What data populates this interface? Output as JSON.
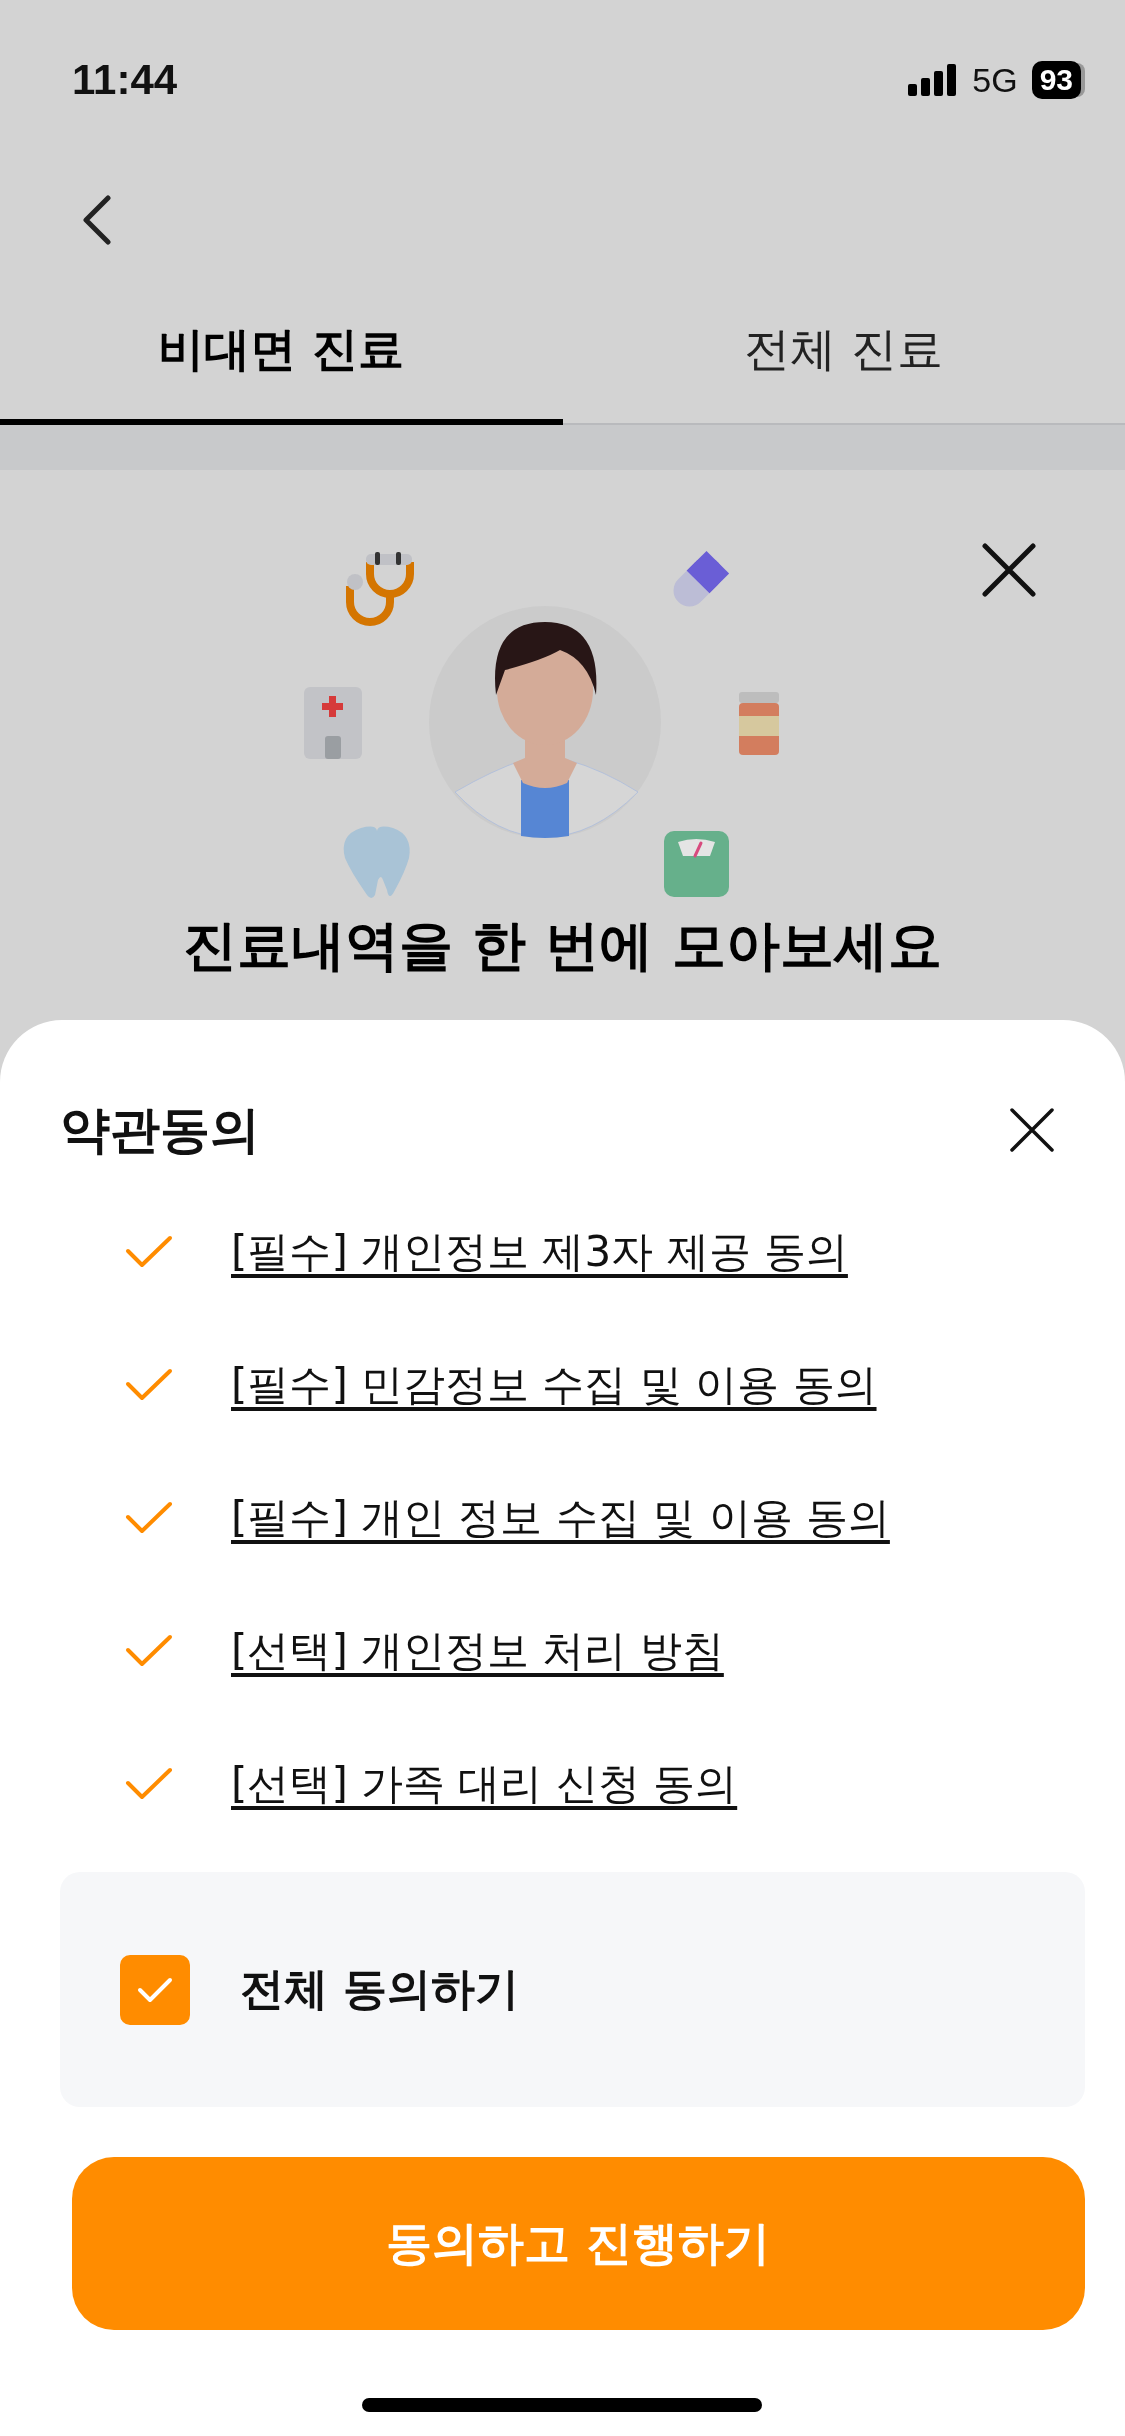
{
  "status_bar": {
    "time": "11:44",
    "network": "5G",
    "battery": "93"
  },
  "tabs": [
    {
      "label": "비대면 진료",
      "selected": true
    },
    {
      "label": "전체 진료",
      "selected": false
    }
  ],
  "banner": {
    "heading": "진료내역을 한 번에 모아보세요"
  },
  "sheet": {
    "title": "약관동의",
    "terms": [
      {
        "label": "[필수] 개인정보 제3자 제공 동의",
        "checked": true
      },
      {
        "label": "[필수] 민감정보 수집 및 이용 동의",
        "checked": true
      },
      {
        "label": "[필수] 개인 정보 수집 및 이용 동의",
        "checked": true
      },
      {
        "label": "[선택] 개인정보 처리 방침",
        "checked": true
      },
      {
        "label": "[선택] 가족 대리 신청 동의",
        "checked": true
      }
    ],
    "agree_all": {
      "label": "전체 동의하기",
      "checked": true
    },
    "button": "동의하고 진행하기"
  }
}
